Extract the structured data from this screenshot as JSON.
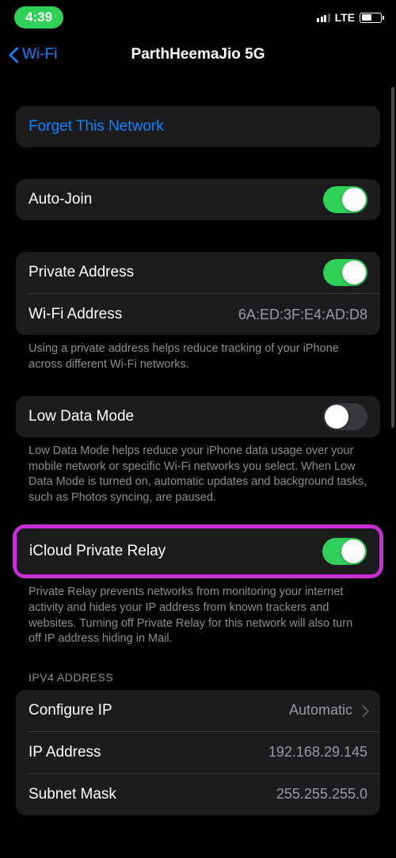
{
  "status": {
    "time": "4:39",
    "network": "LTE"
  },
  "nav": {
    "back": "Wi-Fi",
    "title": "ParthHeemaJio 5G"
  },
  "forget": {
    "label": "Forget This Network"
  },
  "autojoin": {
    "label": "Auto-Join",
    "on": true
  },
  "private_addr": {
    "label": "Private Address",
    "on": true,
    "wifi_label": "Wi-Fi Address",
    "wifi_value": "6A:ED:3F:E4:AD:D8",
    "footer": "Using a private address helps reduce tracking of your iPhone across different Wi-Fi networks."
  },
  "low_data": {
    "label": "Low Data Mode",
    "on": false,
    "footer": "Low Data Mode helps reduce your iPhone data usage over your mobile network or specific Wi-Fi networks you select. When Low Data Mode is turned on, automatic updates and background tasks, such as Photos syncing, are paused."
  },
  "relay": {
    "label": "iCloud Private Relay",
    "on": true,
    "footer": "Private Relay prevents networks from monitoring your internet activity and hides your IP address from known trackers and websites. Turning off Private Relay for this network will also turn off IP address hiding in Mail."
  },
  "ipv4": {
    "header": "IPV4 ADDRESS",
    "configure_label": "Configure IP",
    "configure_value": "Automatic",
    "ip_label": "IP Address",
    "ip_value": "192.168.29.145",
    "mask_label": "Subnet Mask",
    "mask_value": "255.255.255.0"
  }
}
